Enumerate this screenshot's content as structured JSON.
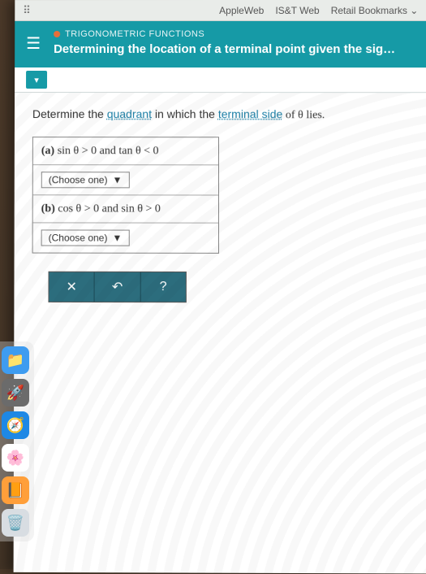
{
  "toolbar": {
    "links": [
      "AppleWeb",
      "IS&T Web",
      "Retail Bookmarks"
    ]
  },
  "banner": {
    "crumb": "TRIGONOMETRIC FUNCTIONS",
    "title": "Determining the location of a terminal point given the sig…"
  },
  "prompt": {
    "pre": "Determine the ",
    "link1": "quadrant",
    "mid": " in which the ",
    "link2": "terminal side",
    "post": " of θ lies."
  },
  "parts": {
    "a": {
      "label": "(a)",
      "expr": "sin θ > 0 and tan θ < 0",
      "choose": "(Choose one)"
    },
    "b": {
      "label": "(b)",
      "expr": "cos θ > 0 and sin θ > 0",
      "choose": "(Choose one)"
    }
  },
  "buttons": {
    "clear": "✕",
    "undo": "↶",
    "help": "?"
  },
  "dock": [
    "finder",
    "launchpad",
    "safari",
    "photos",
    "books",
    "trash"
  ]
}
